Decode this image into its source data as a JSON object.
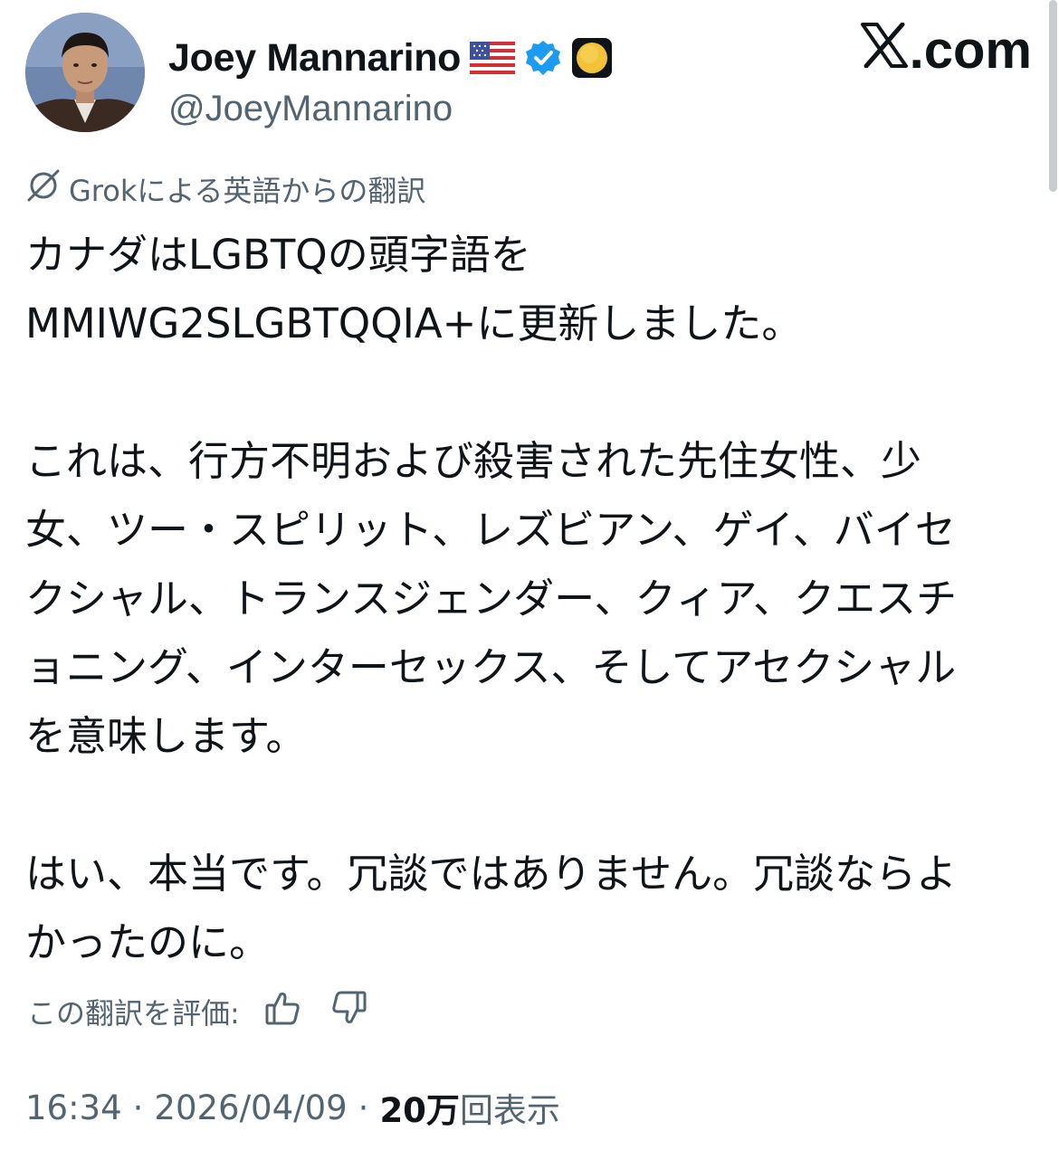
{
  "author": {
    "display_name": "Joey Mannarino",
    "handle": "@JoeyMannarino",
    "badges": [
      "us-flag-emoji",
      "verified-badge-icon",
      "yellow-circle-emoji"
    ]
  },
  "brand": {
    "logo_letter": "𝕏",
    "logo_suffix": ".com"
  },
  "translation_note": "Grokによる英語からの翻訳",
  "post": {
    "paragraphs": [
      "カナダはLGBTQの頭字語を\nMMIWG2SLGBTQQIA+に更新しました。",
      "これは、行方不明および殺害された先住女性、少\n女、ツー・スピリット、レズビアン、ゲイ、バイセ\nクシャル、トランスジェンダー、クィア、クエスチ\nョニング、インターセックス、そしてアセクシャル\nを意味します。",
      "はい、本当です。冗談ではありません。冗談ならよ\nかったのに。"
    ]
  },
  "rating": {
    "label": "この翻訳を評価:",
    "like_icon": "thumbs-up-icon",
    "dislike_icon": "thumbs-down-icon"
  },
  "meta": {
    "time": "16:34",
    "separator": "·",
    "date": "2026/04/09",
    "views_count": "20万",
    "views_label": "回表示"
  },
  "colors": {
    "text_primary": "#0f1419",
    "text_secondary": "#536471",
    "verified_blue": "#1d9bf0",
    "background": "#ffffff"
  }
}
